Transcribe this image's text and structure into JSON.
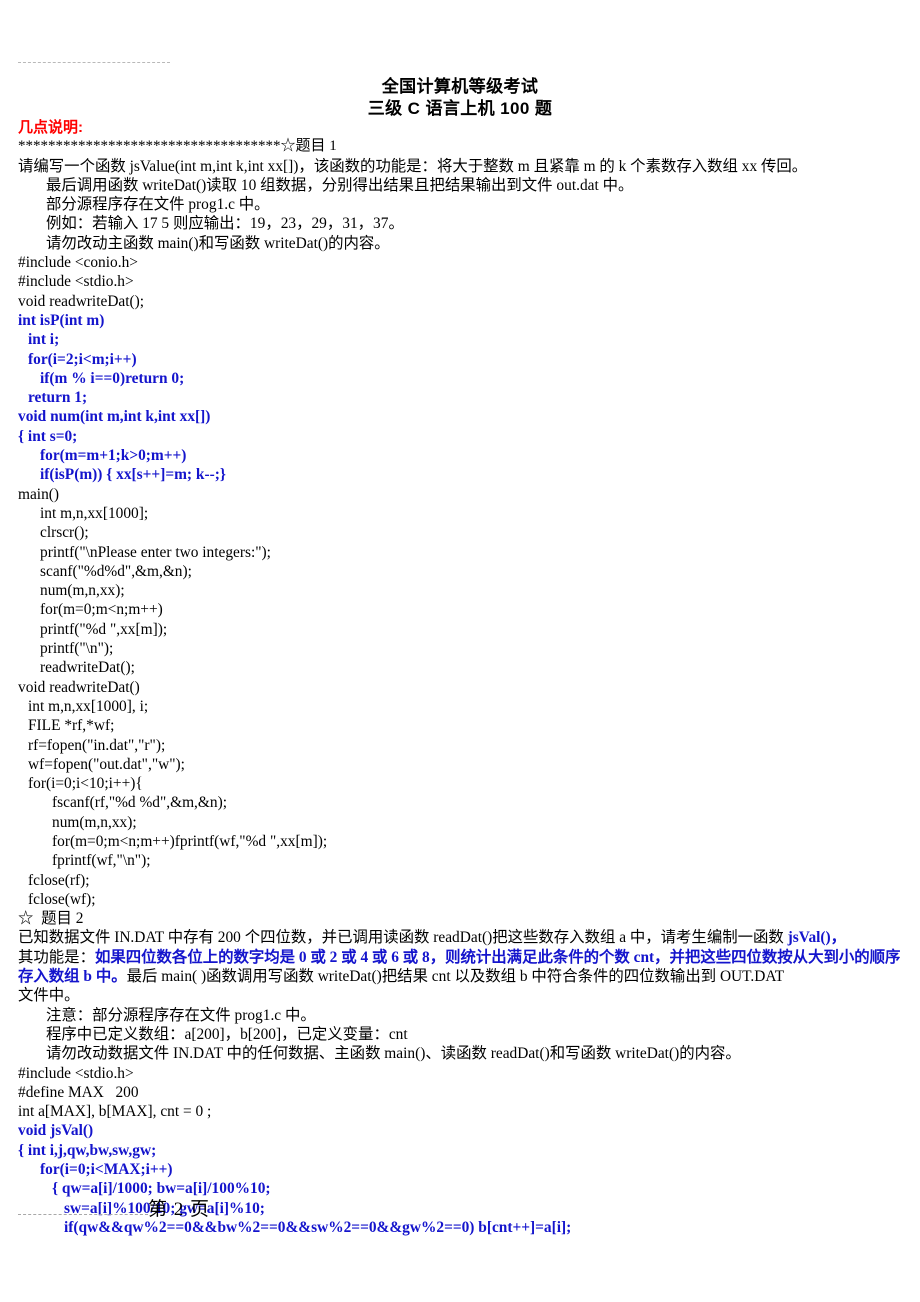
{
  "document": {
    "title_lines": [
      "全国计算机等级考试",
      "三级 C 语言上机 100 题"
    ],
    "section_heading": "几点说明:",
    "separator_stars": "***********************************☆题目 1",
    "footer_page": "第 2 页"
  },
  "problem1": {
    "intro": [
      "请编写一个函数 jsValue(int m,int k,int xx[])，该函数的功能是：将大于整数 m 且紧靠 m 的 k 个素数存入数组 xx 传回。",
      "最后调用函数 writeDat()读取 10 组数据，分别得出结果且把结果输出到文件 out.dat 中。",
      "部分源程序存在文件 prog1.c 中。",
      "例如：若输入 17 5 则应输出：19，23，29，31，37。",
      "请勿改动主函数 main()和写函数 writeDat()的内容。"
    ],
    "code": [
      {
        "text": "#include <conio.h>",
        "color": "black",
        "indent": 0
      },
      {
        "text": "#include <stdio.h>",
        "color": "black",
        "indent": 0
      },
      {
        "text": "void readwriteDat();",
        "color": "black",
        "indent": 0
      },
      {
        "text": "int isP(int m)",
        "color": "blue",
        "indent": 0
      },
      {
        "text": "int i;",
        "color": "blue",
        "indent": 1
      },
      {
        "text": "for(i=2;i<m;i++)",
        "color": "blue",
        "indent": 1
      },
      {
        "text": "if(m % i==0)return 0;",
        "color": "blue",
        "indent": 2
      },
      {
        "text": "return 1;",
        "color": "blue",
        "indent": 1
      },
      {
        "text": "void num(int m,int k,int xx[])",
        "color": "blue",
        "indent": 0
      },
      {
        "text": "{ int s=0;",
        "color": "blue",
        "indent": 0
      },
      {
        "text": "for(m=m+1;k>0;m++)",
        "color": "blue",
        "indent": 2
      },
      {
        "text": "if(isP(m)) { xx[s++]=m; k--;}",
        "color": "blue",
        "indent": 2
      },
      {
        "text": "main()",
        "color": "black",
        "indent": 0
      },
      {
        "text": "int m,n,xx[1000];",
        "color": "black",
        "indent": 2
      },
      {
        "text": "clrscr();",
        "color": "black",
        "indent": 2
      },
      {
        "text": "printf(\"\\nPlease enter two integers:\");",
        "color": "black",
        "indent": 2
      },
      {
        "text": "scanf(\"%d%d\",&m,&n);",
        "color": "black",
        "indent": 2
      },
      {
        "text": "num(m,n,xx);",
        "color": "black",
        "indent": 2
      },
      {
        "text": "for(m=0;m<n;m++)",
        "color": "black",
        "indent": 2
      },
      {
        "text": "printf(\"%d \",xx[m]);",
        "color": "black",
        "indent": 2
      },
      {
        "text": "printf(\"\\n\");",
        "color": "black",
        "indent": 2
      },
      {
        "text": "readwriteDat();",
        "color": "black",
        "indent": 2
      },
      {
        "text": "void readwriteDat()",
        "color": "black",
        "indent": 0
      },
      {
        "text": "int m,n,xx[1000], i;",
        "color": "black",
        "indent": 1
      },
      {
        "text": "FILE *rf,*wf;",
        "color": "black",
        "indent": 1
      },
      {
        "text": "rf=fopen(\"in.dat\",\"r\");",
        "color": "black",
        "indent": 1
      },
      {
        "text": "wf=fopen(\"out.dat\",\"w\");",
        "color": "black",
        "indent": 1
      },
      {
        "text": "for(i=0;i<10;i++){",
        "color": "black",
        "indent": 1
      },
      {
        "text": "fscanf(rf,\"%d %d\",&m,&n);",
        "color": "black",
        "indent": 3
      },
      {
        "text": "num(m,n,xx);",
        "color": "black",
        "indent": 3
      },
      {
        "text": "for(m=0;m<n;m++)fprintf(wf,\"%d \",xx[m]);",
        "color": "black",
        "indent": 3
      },
      {
        "text": "fprintf(wf,\"\\n\");",
        "color": "black",
        "indent": 3
      },
      {
        "text": "fclose(rf);",
        "color": "black",
        "indent": 1
      },
      {
        "text": "fclose(wf);",
        "color": "black",
        "indent": 1
      }
    ]
  },
  "problem2": {
    "heading": "☆  题目 2",
    "desc_part1": "已知数据文件 IN.DAT 中存有 200 个四位数，并已调用读函数 readDat()把这些数存入数组 a 中，请考生编制一函数 ",
    "desc_fn_blue": "jsVal()，",
    "desc_part2": "其功能是：",
    "desc_blue": "如果四位数各位上的数字均是 0 或 2 或 4 或 6 或 8，则统计出满足此条件的个数 cnt，并把这些四位数按从大到小的顺序存入数组 b 中。",
    "desc_part3": "最后 main( )函数调用写函数 writeDat()把结果 cnt 以及数组 b 中符合条件的四位数输出到 OUT.DAT",
    "desc_part4": "文件中。",
    "notes": [
      "注意：部分源程序存在文件 prog1.c 中。",
      "程序中已定义数组：a[200]，b[200]，已定义变量：cnt",
      "请勿改动数据文件 IN.DAT 中的任何数据、主函数 main()、读函数 readDat()和写函数 writeDat()的内容。"
    ],
    "code": [
      {
        "text": "#include <stdio.h>",
        "color": "black",
        "indent": 0
      },
      {
        "text": "#define MAX   200",
        "color": "black",
        "indent": 0
      },
      {
        "text": "int a[MAX], b[MAX], cnt = 0 ;",
        "color": "black",
        "indent": 0
      },
      {
        "text": "void jsVal()",
        "color": "blue",
        "indent": 0
      },
      {
        "text": "{ int i,j,qw,bw,sw,gw;",
        "color": "blue",
        "indent": 0
      },
      {
        "text": "for(i=0;i<MAX;i++)",
        "color": "blue",
        "indent": 2
      },
      {
        "text": "{ qw=a[i]/1000; bw=a[i]/100%10;",
        "color": "blue",
        "indent": 3
      },
      {
        "text": "sw=a[i]%100/10; gw=a[i]%10;",
        "color": "blue",
        "indent": 4
      },
      {
        "text": "if(qw&&qw%2==0&&bw%2==0&&sw%2==0&&gw%2==0) b[cnt++]=a[i];",
        "color": "blue",
        "indent": 4
      }
    ]
  },
  "colors": {
    "red_heading": "#ff0000",
    "blue_code": "#1414cc",
    "body_text": "#000000",
    "rule_gray": "#b9b9b9"
  }
}
